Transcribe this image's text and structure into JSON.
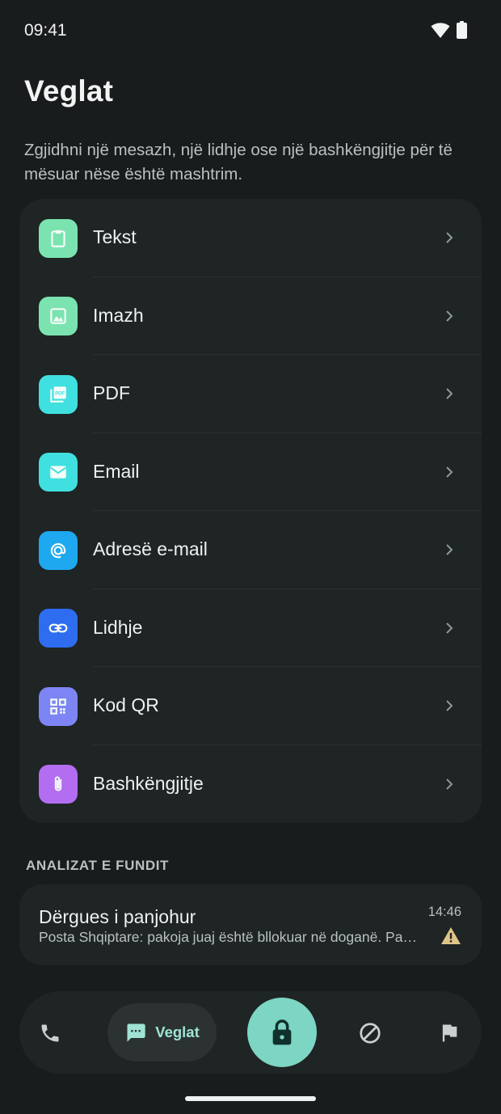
{
  "status_bar": {
    "time": "09:41",
    "icons": [
      "wifi-icon",
      "battery-icon"
    ]
  },
  "header": {
    "title": "Veglat",
    "subtitle": "Zgjidhni një mesazh, një lidhje ose një bashkëngjitje për të mësuar nëse është mashtrim."
  },
  "tools": [
    {
      "label": "Tekst",
      "icon": "clipboard-icon",
      "color": "#7be3b0"
    },
    {
      "label": "Imazh",
      "icon": "image-icon",
      "color": "#7be3b0"
    },
    {
      "label": "PDF",
      "icon": "pdf-icon",
      "color": "#3fe0df"
    },
    {
      "label": "Email",
      "icon": "mail-icon",
      "color": "#3fe0df"
    },
    {
      "label": "Adresë e-mail",
      "icon": "at-sign-icon",
      "color": "#1ea8f0"
    },
    {
      "label": "Lidhje",
      "icon": "link-icon",
      "color": "#2e6cf0"
    },
    {
      "label": "Kod QR",
      "icon": "qr-code-icon",
      "color": "#7d85f5"
    },
    {
      "label": "Bashkëngjitje",
      "icon": "paperclip-icon",
      "color": "#b26df0"
    }
  ],
  "recent": {
    "heading": "ANALIZAT E FUNDIT",
    "items": [
      {
        "sender": "Dërgues i panjohur",
        "preview": "Posta Shqiptare: pakoja juaj është bllokuar në doganë. Paguani tarifën këtu",
        "time": "14:46",
        "status_icon": "warning-icon",
        "status_color": "#e0c58a"
      }
    ]
  },
  "bottom_nav": {
    "items": [
      {
        "name": "calls",
        "icon": "phone-icon"
      },
      {
        "name": "tools",
        "icon": "message-icon",
        "label": "Veglat",
        "selected": true
      },
      {
        "name": "protect",
        "icon": "lock-icon"
      },
      {
        "name": "block",
        "icon": "block-icon"
      },
      {
        "name": "report",
        "icon": "flag-icon"
      }
    ]
  },
  "colors": {
    "background": "#181c1c",
    "card": "#1f2424",
    "accent": "#7dd5c3",
    "accent_text": "#9fe3d4"
  }
}
